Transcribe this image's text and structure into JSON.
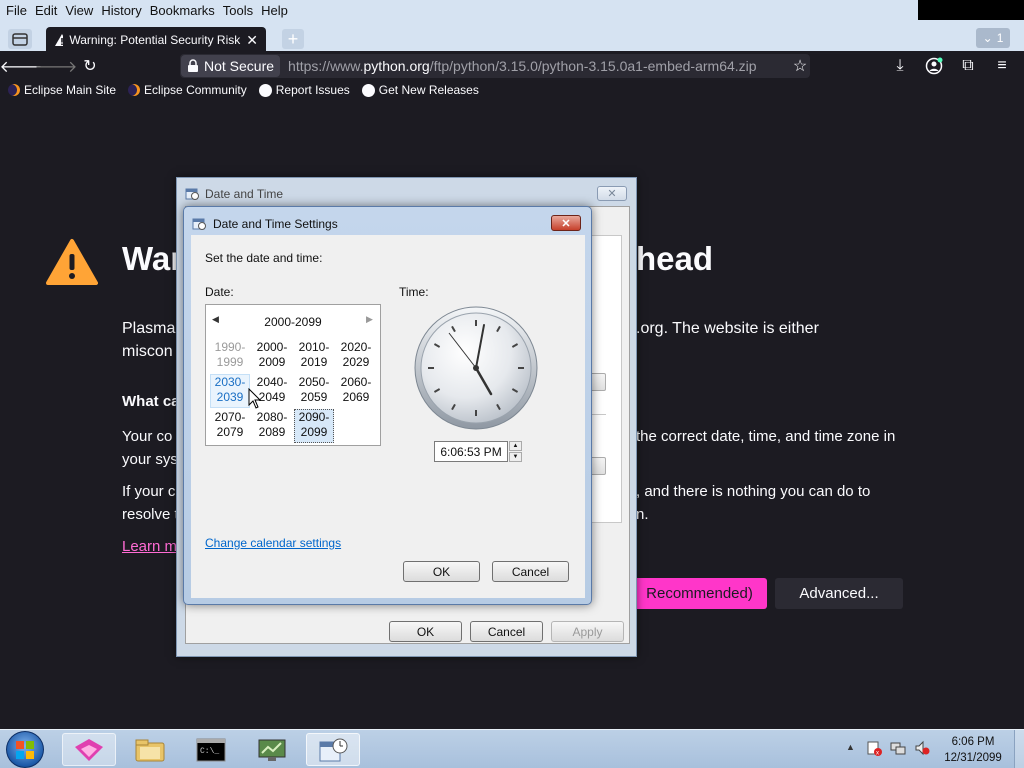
{
  "menubar": {
    "items": [
      "File",
      "Edit",
      "View",
      "History",
      "Bookmarks",
      "Tools",
      "Help"
    ]
  },
  "tab": {
    "title": "Warning: Potential Security Risk",
    "overflow_count": "1"
  },
  "urlbar": {
    "security_label": "Not Secure",
    "url_prefix": "https://www.",
    "url_domain": "python.org",
    "url_path": "/ftp/python/3.15.0/python-3.15.0a1-embed-arm64.zip"
  },
  "bookmarks": [
    "Eclipse Main Site",
    "Eclipse Community",
    "Report Issues",
    "Get New Releases"
  ],
  "page": {
    "heading_left": "War",
    "heading_right": "head",
    "para1_left_line1": "Plasma",
    "para1_left_line2": "miscon",
    "para1_right": ".org. The website is either",
    "what_can": "What ca",
    "para2_left_line1": "Your co",
    "para2_left_line2": "your sys",
    "para2_right": "the correct date, time, and time zone in",
    "para3_left_line1": "If your c",
    "para3_left_line2": "resolve t",
    "para3_right_line1": ", and there is nothing you can do to",
    "para3_right_line2": "n.",
    "learn_more": "Learn m",
    "recommended_btn": "Recommended)",
    "advanced_btn": "Advanced..."
  },
  "outer_dialog": {
    "title": "Date and Time",
    "ok": "OK",
    "cancel": "Cancel",
    "apply": "Apply"
  },
  "inner_dialog": {
    "title": "Date and Time Settings",
    "instruction": "Set the date and time:",
    "date_label": "Date:",
    "time_label": "Time:",
    "century_header": "2000-2099",
    "decades": [
      {
        "top": "1990-",
        "bottom": "1999",
        "state": "grayed"
      },
      {
        "top": "2000-",
        "bottom": "2009",
        "state": "normal"
      },
      {
        "top": "2010-",
        "bottom": "2019",
        "state": "normal"
      },
      {
        "top": "2020-",
        "bottom": "2029",
        "state": "normal"
      },
      {
        "top": "2030-",
        "bottom": "2039",
        "state": "hover"
      },
      {
        "top": "2040-",
        "bottom": "2049",
        "state": "normal"
      },
      {
        "top": "2050-",
        "bottom": "2059",
        "state": "normal"
      },
      {
        "top": "2060-",
        "bottom": "2069",
        "state": "normal"
      },
      {
        "top": "2070-",
        "bottom": "2079",
        "state": "normal"
      },
      {
        "top": "2080-",
        "bottom": "2089",
        "state": "normal"
      },
      {
        "top": "2090-",
        "bottom": "2099",
        "state": "selected"
      }
    ],
    "time_value": "6:06:53 PM",
    "change_calendar_link": "Change calendar settings",
    "ok": "OK",
    "cancel": "Cancel"
  },
  "taskbar": {
    "clock_time": "6:06 PM",
    "clock_date": "12/31/2099"
  },
  "colors": {
    "accent_pink": "#ff36c9",
    "warning_yellow": "#ffa436",
    "link_blue": "#0066cc"
  }
}
